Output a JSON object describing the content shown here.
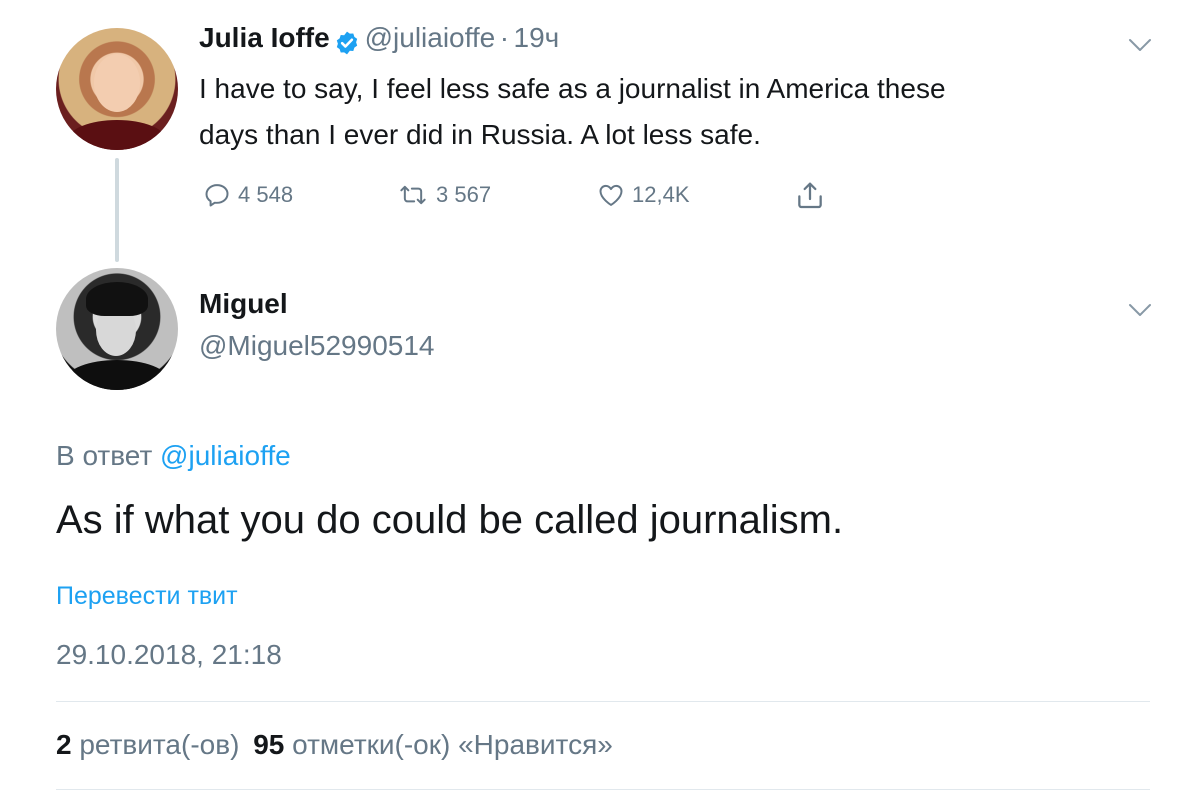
{
  "original_tweet": {
    "author_name": "Julia Ioffe",
    "author_handle": "@juliaioffe",
    "separator": "·",
    "time_ago": "19ч",
    "text_line1": "I have to say, I feel less safe as a journalist in America these",
    "text_line2": "days than I ever did in Russia. A lot less safe.",
    "replies": "4 548",
    "retweets": "3 567",
    "likes": "12,4K",
    "icons": [
      "verified-badge-icon",
      "reply-icon",
      "retweet-icon",
      "like-icon",
      "share-icon",
      "chevron-down-icon"
    ]
  },
  "reply_tweet": {
    "author_name": "Miguel",
    "author_handle": "@Miguel52990514",
    "in_reply_prefix": "В ответ",
    "in_reply_handle": "@juliaioffe",
    "text": "As if what you do could be called journalism.",
    "translate_label": "Перевести твит",
    "timestamp": "29.10.2018, 21:18"
  },
  "stats": {
    "retweet_count": "2",
    "retweet_label": "ретвита(-ов)",
    "like_count": "95",
    "like_label": "отметки(-ок) «Нравится»"
  },
  "colors": {
    "accent": "#1da1f2",
    "muted": "#657786",
    "text": "#14171a",
    "divider": "#e1e8ed"
  }
}
